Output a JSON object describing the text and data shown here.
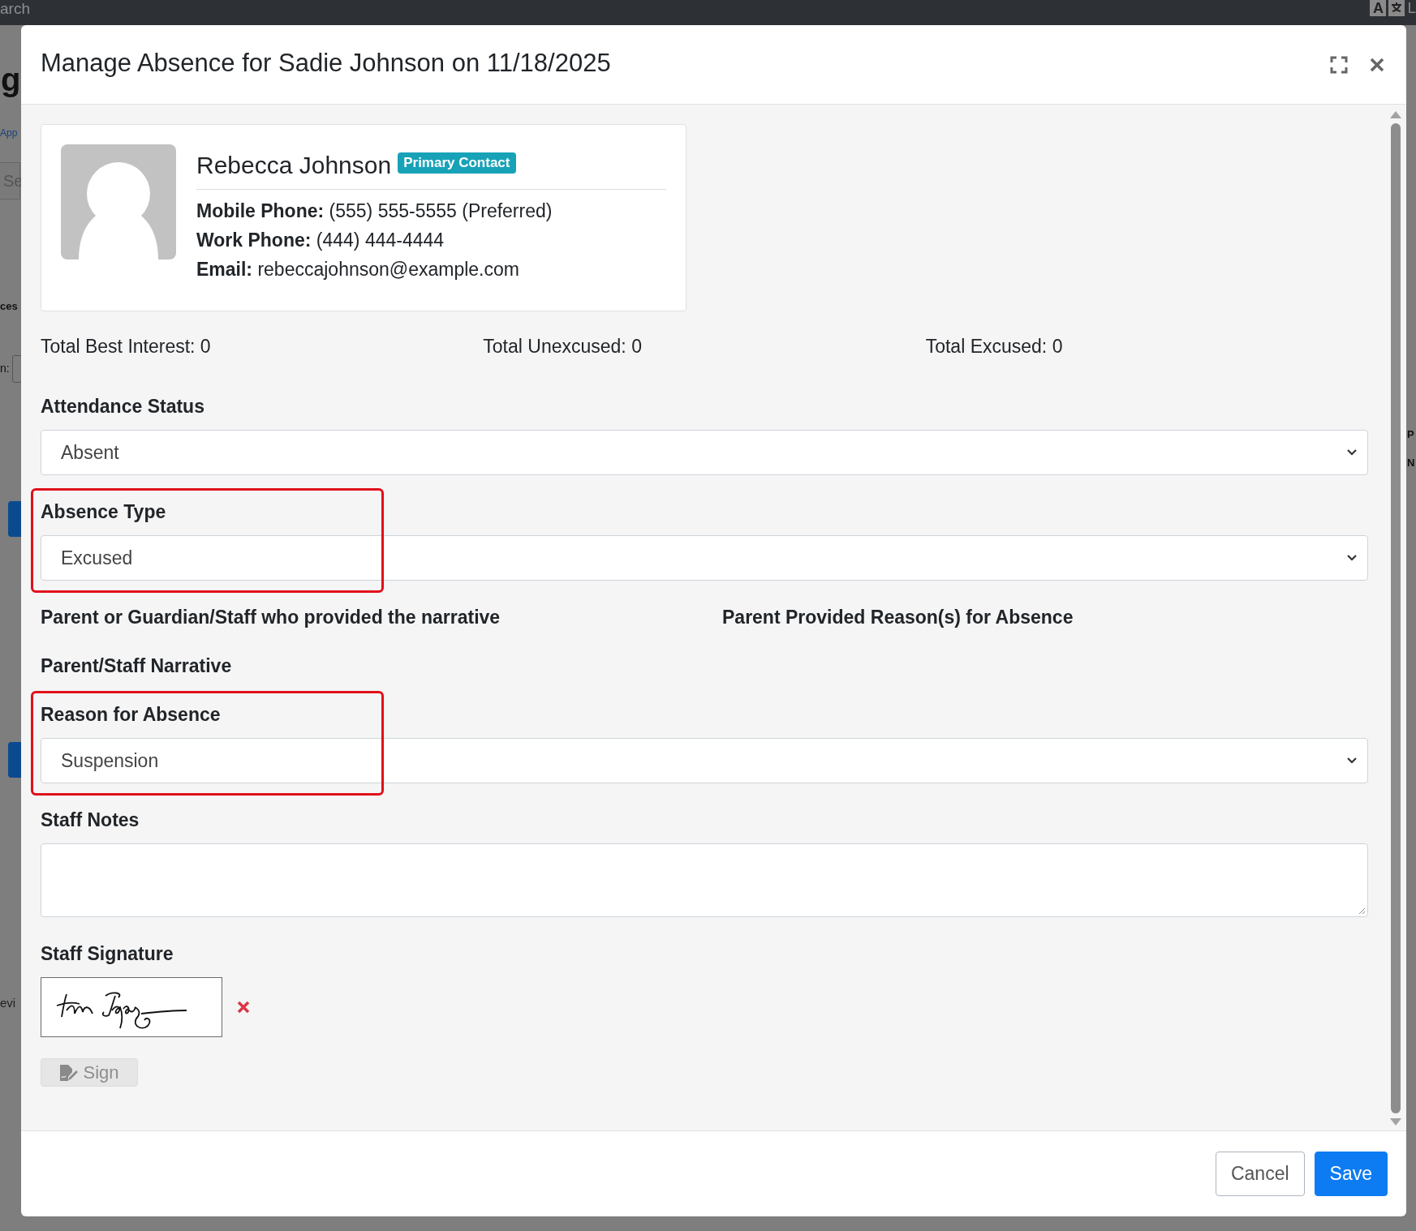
{
  "background": {
    "top_bar_text": "arch",
    "lang_key": "A",
    "corner_text": "L",
    "fragments": [
      {
        "kind": "heading",
        "text": "g"
      },
      {
        "kind": "link",
        "text": "App"
      },
      {
        "kind": "input",
        "text": "Se"
      },
      {
        "kind": "section",
        "text": "ces"
      },
      {
        "kind": "label",
        "text": "n:"
      },
      {
        "kind": "blue-button"
      },
      {
        "kind": "blue-button"
      },
      {
        "kind": "text",
        "text": "evi"
      },
      {
        "kind": "right-bold",
        "text": "P"
      },
      {
        "kind": "right-bold",
        "text": "N"
      }
    ]
  },
  "dialog": {
    "title": "Manage Absence for Sadie Johnson on 11/18/2025"
  },
  "contact": {
    "name": "Rebecca Johnson",
    "badge": "Primary Contact",
    "details": [
      {
        "label": "Mobile Phone:",
        "value": "(555) 555-5555 (Preferred)"
      },
      {
        "label": "Work Phone:",
        "value": "(444) 444-4444"
      },
      {
        "label": "Email:",
        "value": "rebeccajohnson@example.com"
      }
    ]
  },
  "totals": [
    "Total Best Interest: 0",
    "Total Unexcused: 0",
    "Total Excused: 0"
  ],
  "fields": [
    {
      "kind": "select",
      "label": "Attendance Status",
      "value": "Absent",
      "highlighted": false
    },
    {
      "kind": "select",
      "label": "Absence Type",
      "value": "Excused",
      "highlighted": true
    },
    {
      "kind": "label-pair",
      "labels": [
        "Parent or Guardian/Staff who provided the narrative",
        "Parent Provided Reason(s) for Absence"
      ]
    },
    {
      "kind": "label",
      "label": "Parent/Staff Narrative"
    },
    {
      "kind": "select",
      "label": "Reason for Absence",
      "value": "Suspension",
      "highlighted": true
    },
    {
      "kind": "textarea",
      "label": "Staff Notes"
    }
  ],
  "signature": {
    "label": "Staff Signature",
    "signed": true,
    "sign_button": "Sign",
    "sign_disabled": true
  },
  "buttons": [
    {
      "label": "Cancel",
      "kind": "secondary"
    },
    {
      "label": "Save",
      "kind": "primary"
    }
  ]
}
